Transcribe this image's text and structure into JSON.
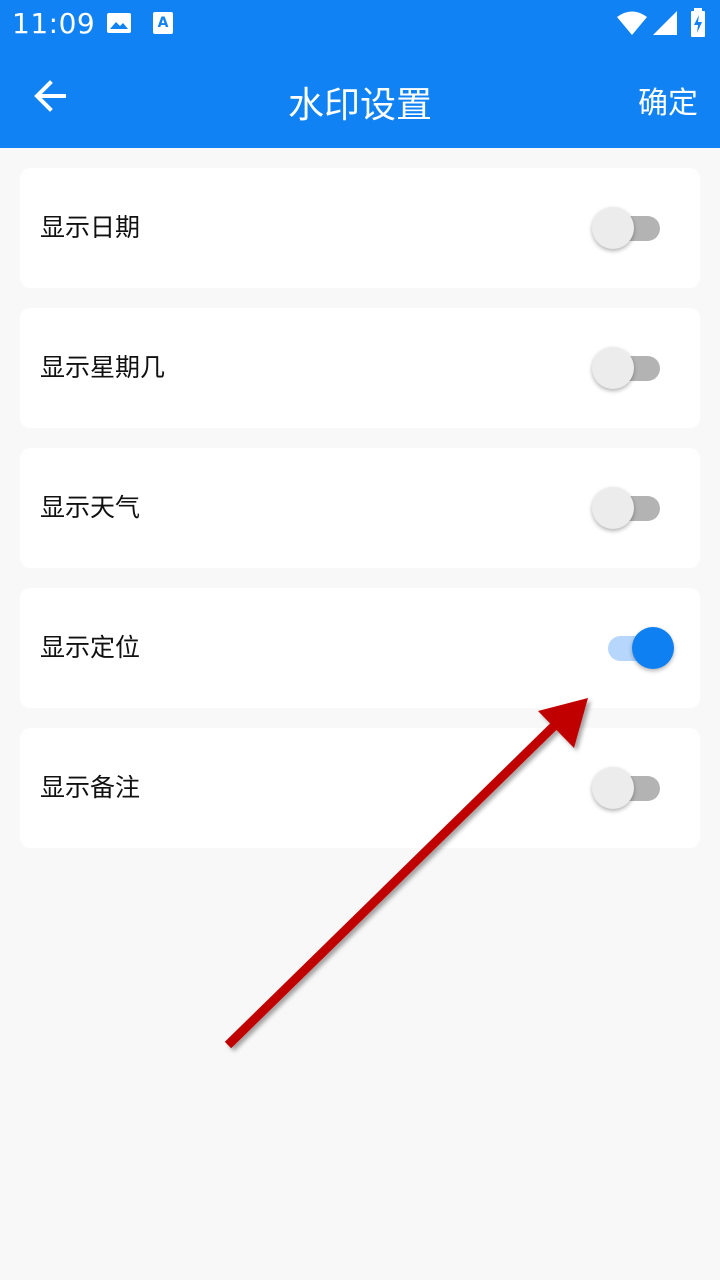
{
  "status_bar": {
    "time": "11:09",
    "icons": [
      "image-icon",
      "text-a-icon",
      "wifi-icon",
      "signal-icon",
      "battery-charging-icon"
    ]
  },
  "app_bar": {
    "back_icon": "arrow-left-icon",
    "title": "水印设置",
    "confirm_label": "确定"
  },
  "settings": [
    {
      "label": "显示日期",
      "enabled": false
    },
    {
      "label": "显示星期几",
      "enabled": false
    },
    {
      "label": "显示天气",
      "enabled": false
    },
    {
      "label": "显示定位",
      "enabled": true
    },
    {
      "label": "显示备注",
      "enabled": false
    }
  ],
  "colors": {
    "primary": "#1182f4",
    "switch_on_thumb": "#0f80f2",
    "switch_on_track": "#b6d6fb",
    "switch_off_thumb": "#ececec",
    "switch_off_track": "#b3b3b3",
    "background": "#f8f8f8",
    "annotation_arrow": "#c00000"
  }
}
